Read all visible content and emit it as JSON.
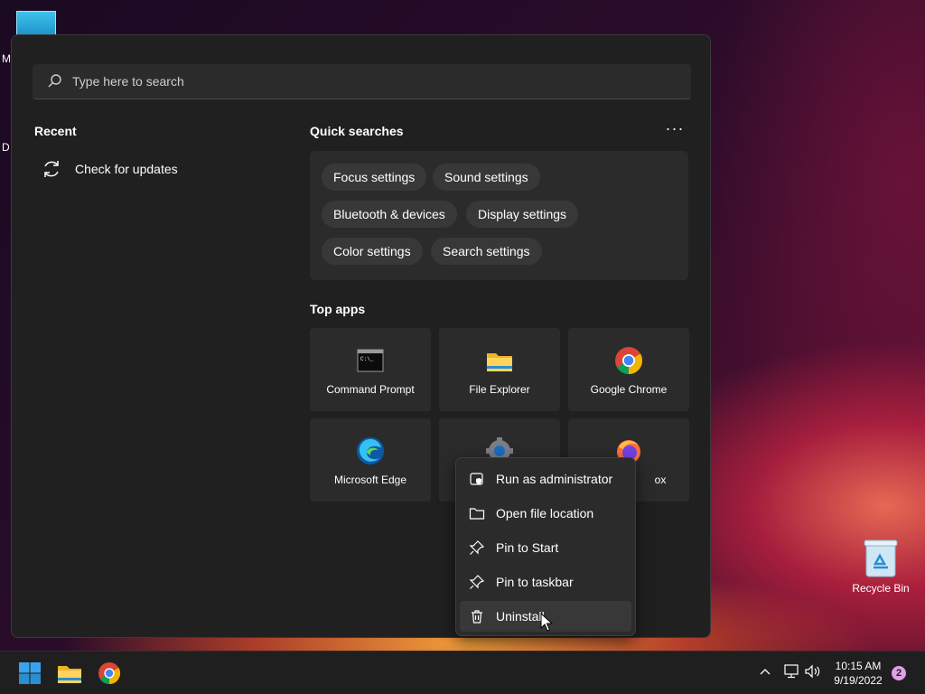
{
  "desktop": {
    "fragment_1": "M",
    "fragment_2": "D",
    "recycle_bin_label": "Recycle Bin"
  },
  "search": {
    "placeholder": "Type here to search"
  },
  "recent": {
    "title": "Recent",
    "items": [
      {
        "label": "Check for updates",
        "icon": "refresh-icon"
      }
    ]
  },
  "quick_searches": {
    "title": "Quick searches",
    "more_label": "···",
    "chips": [
      "Focus settings",
      "Sound settings",
      "Bluetooth & devices",
      "Display settings",
      "Color settings",
      "Search settings"
    ]
  },
  "top_apps": {
    "title": "Top apps",
    "apps": [
      {
        "label": "Command Prompt",
        "icon": "command-prompt-icon"
      },
      {
        "label": "File Explorer",
        "icon": "file-explorer-icon"
      },
      {
        "label": "Google Chrome",
        "icon": "chrome-icon"
      },
      {
        "label": "Microsoft Edge",
        "icon": "edge-icon"
      },
      {
        "label": "",
        "icon": "settings-gear-icon"
      },
      {
        "label": "ox",
        "icon": "firefox-icon"
      }
    ]
  },
  "context_menu": {
    "items": [
      {
        "label": "Run as administrator",
        "icon": "shield-admin-icon"
      },
      {
        "label": "Open file location",
        "icon": "folder-icon"
      },
      {
        "label": "Pin to Start",
        "icon": "pin-icon"
      },
      {
        "label": "Pin to taskbar",
        "icon": "pin-icon"
      },
      {
        "label": "Uninstall",
        "icon": "trash-icon"
      }
    ]
  },
  "taskbar": {
    "time": "10:15 AM",
    "date": "9/19/2022",
    "notification_count": "2"
  },
  "colors": {
    "menu_bg": "#202020",
    "tile_bg": "#2b2b2b",
    "chip_bg": "#383838",
    "windows_blue": "#0078d4"
  }
}
